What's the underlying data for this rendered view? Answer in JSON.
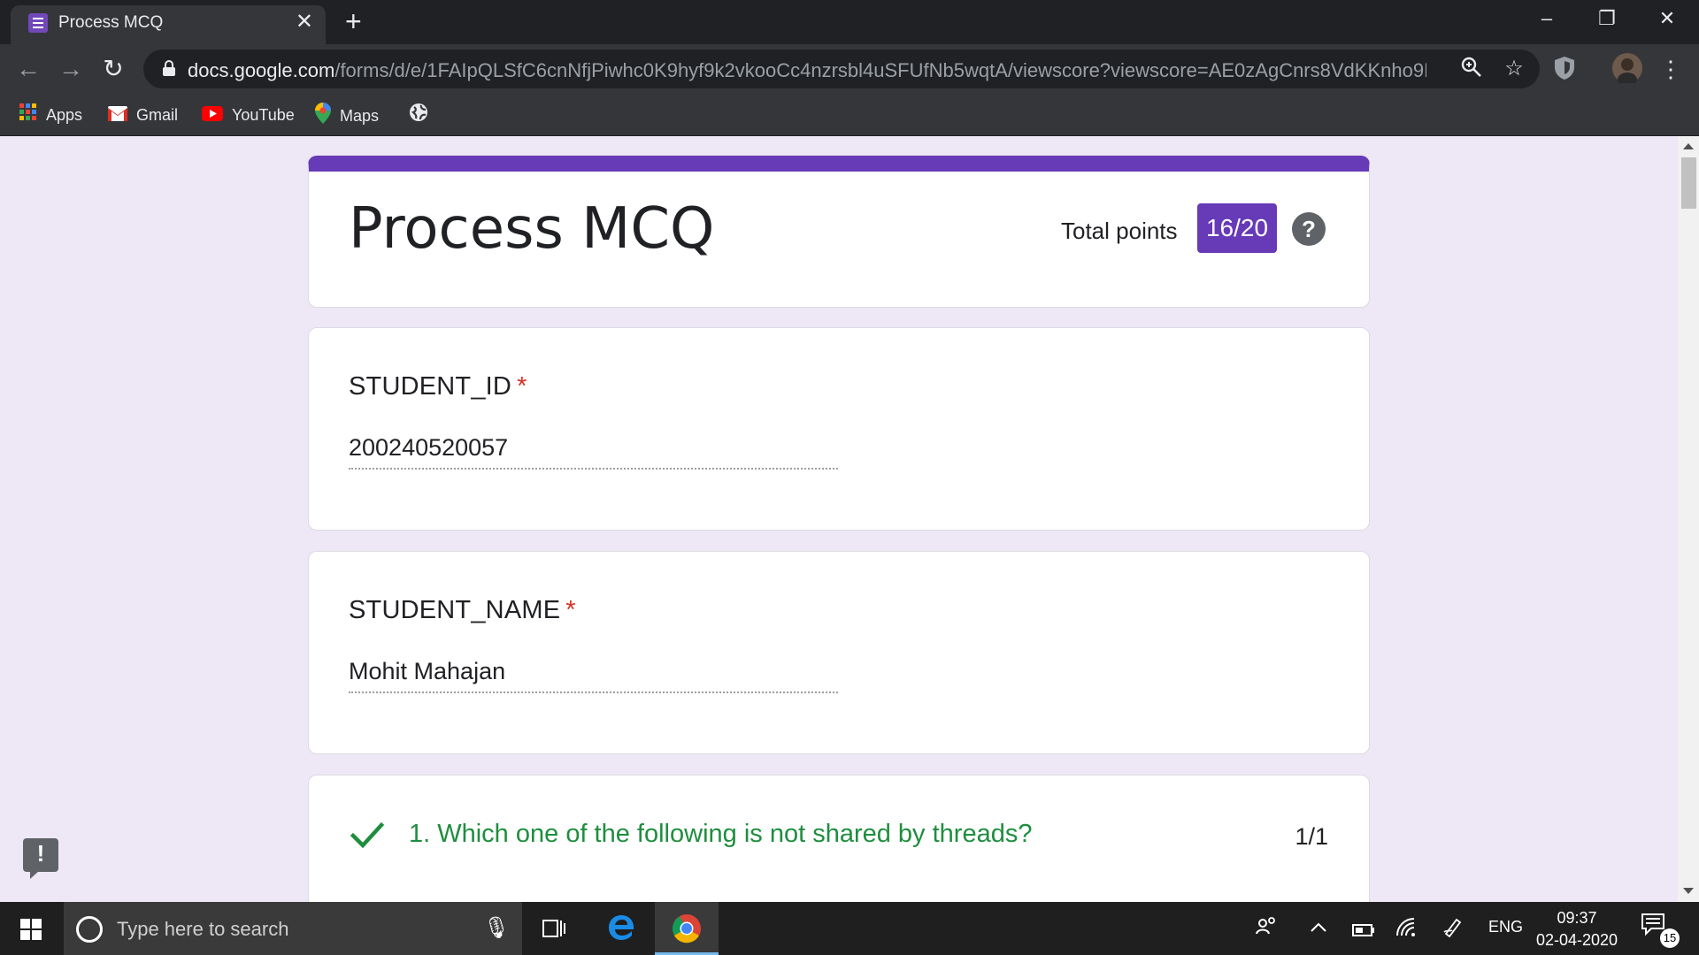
{
  "browser": {
    "tab_title": "Process MCQ",
    "url_host": "docs.google.com",
    "url_path": "/forms/d/e/1FAIpQLSfC6cnNfjPiwhc0K9hyf9k2vkooCc4nzrsbl4uSFUfNb5wqtA/viewscore?viewscore=AE0zAgCnrs8VdKKnho9M-xPJSJxe...",
    "bookmarks": [
      "Apps",
      "Gmail",
      "YouTube",
      "Maps"
    ]
  },
  "form": {
    "title": "Process MCQ",
    "total_points_label": "Total points",
    "score": "16/20",
    "help_glyph": "?",
    "accent_color": "#673ab7",
    "questions": [
      {
        "label": "STUDENT_ID",
        "required_mark": "*",
        "answer": "200240520057"
      },
      {
        "label": "STUDENT_NAME",
        "required_mark": "*",
        "answer": "Mohit Mahajan"
      }
    ],
    "mcq": {
      "text": "1. Which one of the following is not shared by threads?",
      "points": "1/1",
      "status": "correct",
      "correct_color": "#1e8e3e"
    },
    "feedback_glyph": "!"
  },
  "taskbar": {
    "search_placeholder": "Type here to search",
    "language": "ENG",
    "time": "09:37",
    "date": "02-04-2020",
    "notification_count": "15"
  }
}
